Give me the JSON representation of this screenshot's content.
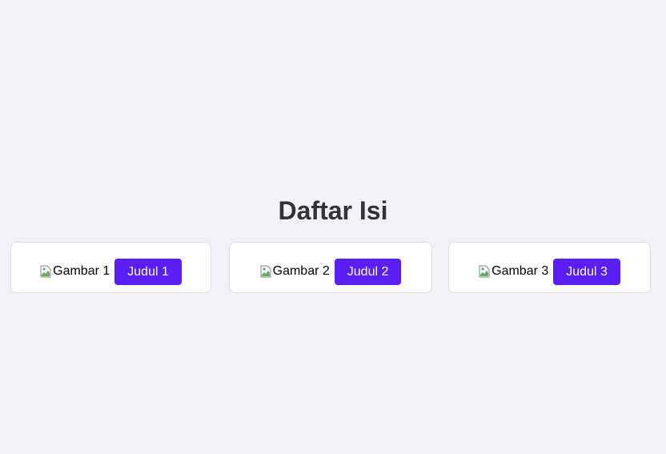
{
  "page": {
    "title": "Daftar Isi"
  },
  "cards": [
    {
      "image_alt": "Gambar 1",
      "button_label": "Judul 1"
    },
    {
      "image_alt": "Gambar 2",
      "button_label": "Judul 2"
    },
    {
      "image_alt": "Gambar 3",
      "button_label": "Judul 3"
    }
  ],
  "colors": {
    "background": "#f3f1f8",
    "button": "#5a1ff5",
    "title": "#333333"
  },
  "icons": {
    "broken_image": "broken-image-icon"
  }
}
